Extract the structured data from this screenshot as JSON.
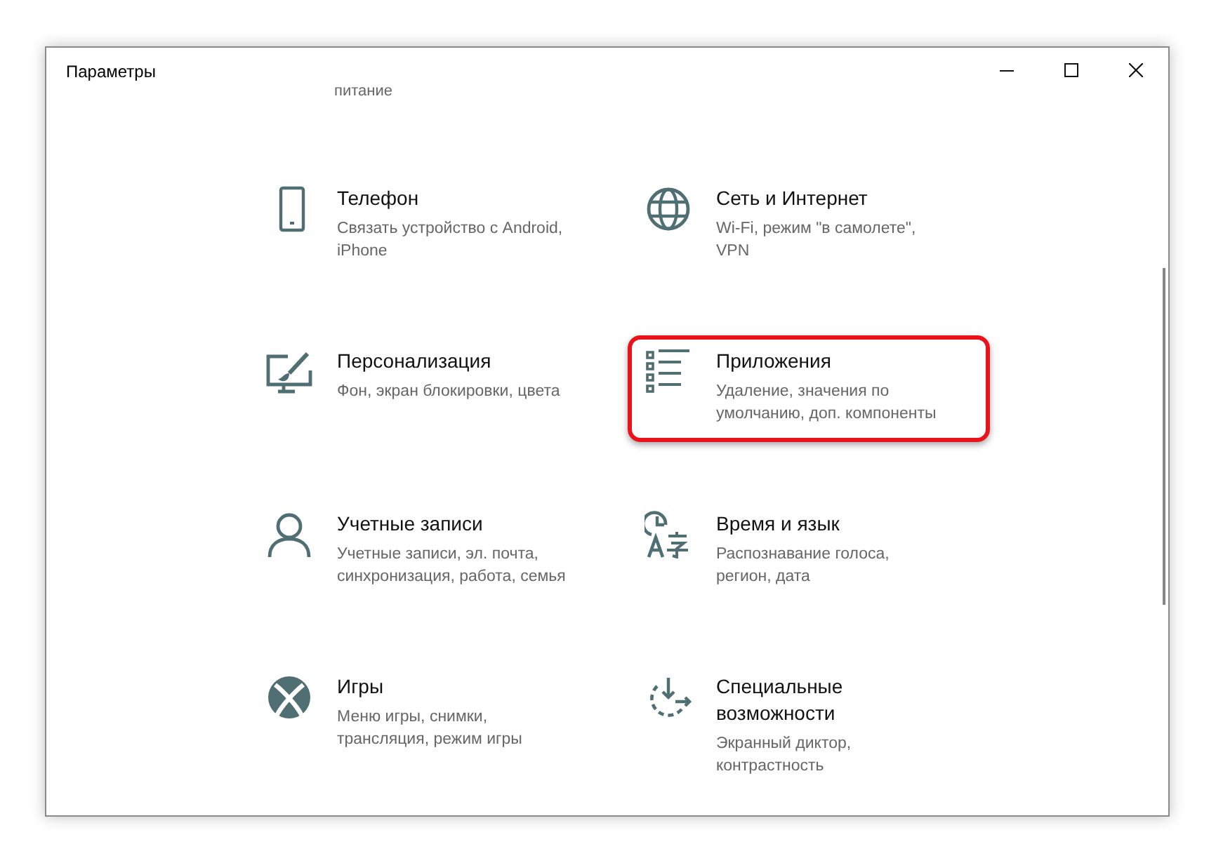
{
  "window": {
    "title": "Параметры"
  },
  "cut_off_description": "питание",
  "categories": [
    {
      "kind": "phone",
      "title_lines": [
        "Телефон"
      ],
      "description_lines": [
        "Связать устройство с Android,",
        "iPhone"
      ],
      "highlighted": false
    },
    {
      "kind": "globe",
      "title_lines": [
        "Сеть и Интернет"
      ],
      "description_lines": [
        "Wi-Fi, режим \"в самолете\",",
        "VPN"
      ],
      "highlighted": false
    },
    {
      "kind": "personalize",
      "title_lines": [
        "Персонализация"
      ],
      "description_lines": [
        "Фон, экран блокировки, цвета"
      ],
      "highlighted": false
    },
    {
      "kind": "apps",
      "title_lines": [
        "Приложения"
      ],
      "description_lines": [
        "Удаление, значения по",
        "умолчанию, доп. компоненты"
      ],
      "highlighted": true
    },
    {
      "kind": "person",
      "title_lines": [
        "Учетные записи"
      ],
      "description_lines": [
        "Учетные записи, эл. почта,",
        "синхронизация, работа, семья"
      ],
      "highlighted": false
    },
    {
      "kind": "time-language",
      "title_lines": [
        "Время и язык"
      ],
      "description_lines": [
        "Распознавание голоса,",
        "регион, дата"
      ],
      "highlighted": false
    },
    {
      "kind": "xbox",
      "title_lines": [
        "Игры"
      ],
      "description_lines": [
        "Меню игры, снимки,",
        "трансляция, режим игры"
      ],
      "highlighted": false
    },
    {
      "kind": "accessibility",
      "title_lines": [
        "Специальные",
        "возможности"
      ],
      "description_lines": [
        "Экранный диктор,",
        "контрастность"
      ],
      "highlighted": false
    }
  ]
}
